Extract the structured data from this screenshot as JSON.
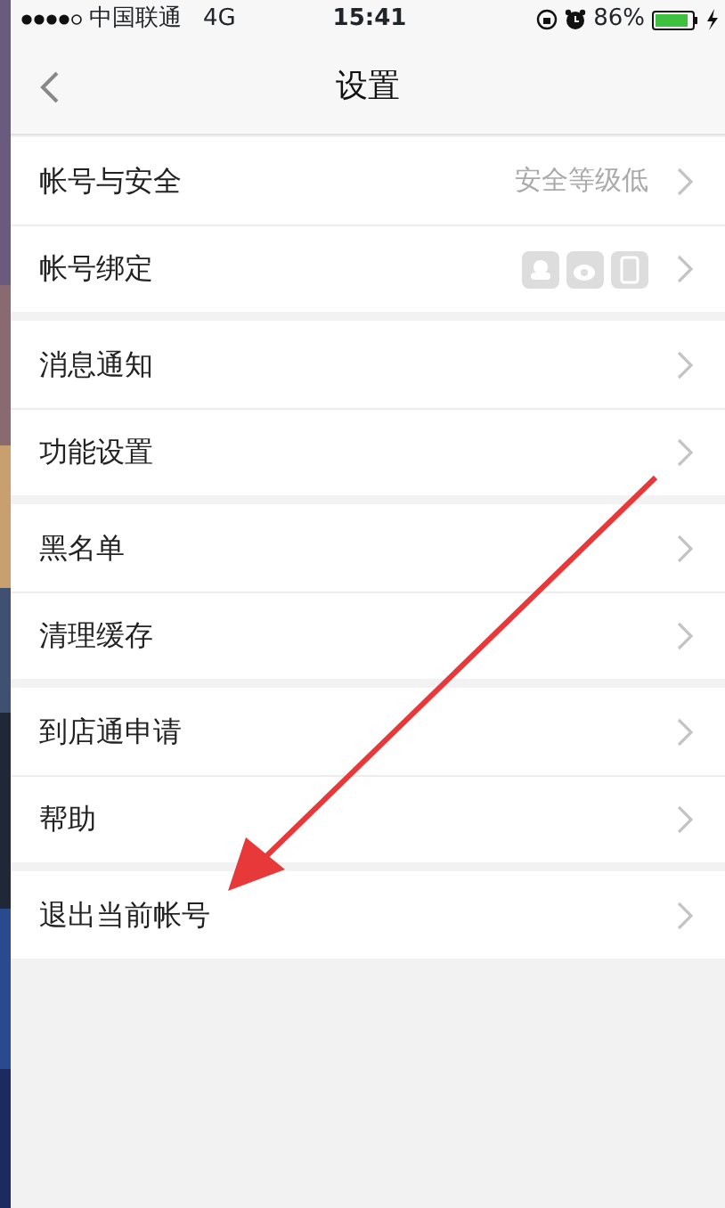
{
  "status_bar": {
    "carrier": "中国联通",
    "network": "4G",
    "time": "15:41",
    "battery": "86%"
  },
  "nav_bar": {
    "title": "设置"
  },
  "groups": [
    {
      "rows": [
        {
          "label": "帐号与安全",
          "kind": "text",
          "value": "安全等级低"
        },
        {
          "label": "帐号绑定",
          "kind": "icons"
        }
      ]
    },
    {
      "rows": [
        {
          "label": "消息通知",
          "kind": "plain"
        },
        {
          "label": "功能设置",
          "kind": "plain"
        }
      ]
    },
    {
      "rows": [
        {
          "label": "黑名单",
          "kind": "plain"
        },
        {
          "label": "清理缓存",
          "kind": "plain"
        }
      ]
    },
    {
      "rows": [
        {
          "label": "到店通申请",
          "kind": "plain"
        },
        {
          "label": "帮助",
          "kind": "plain"
        }
      ]
    },
    {
      "rows": [
        {
          "label": "退出当前帐号",
          "kind": "plain"
        }
      ]
    }
  ]
}
